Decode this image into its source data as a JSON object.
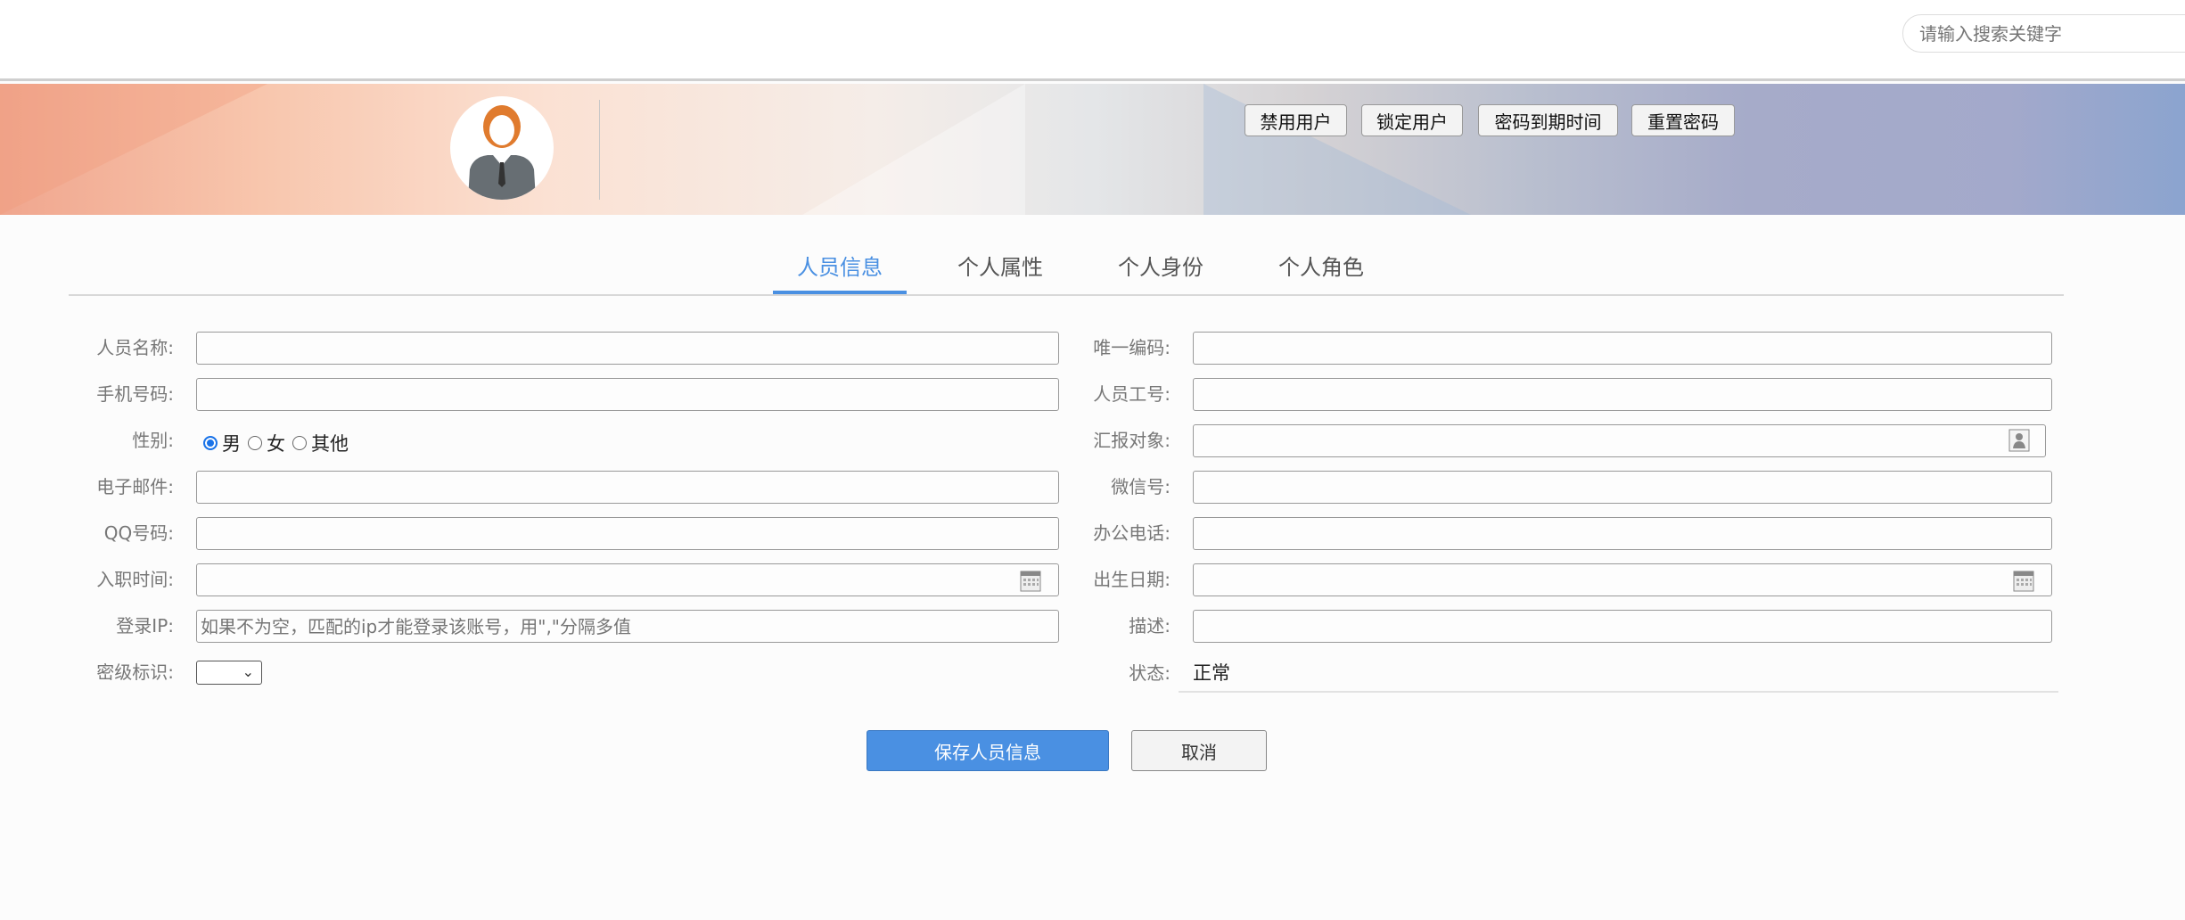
{
  "search": {
    "placeholder": "请输入搜索关键字"
  },
  "header_actions": [
    "禁用用户",
    "锁定用户",
    "密码到期时间",
    "重置密码"
  ],
  "tabs": [
    "人员信息",
    "个人属性",
    "个人身份",
    "个人角色"
  ],
  "active_tab": "人员信息",
  "form": {
    "name_label": "人员名称:",
    "code_label": "唯一编码:",
    "phone_label": "手机号码:",
    "empno_label": "人员工号:",
    "gender_label": "性别:",
    "gender_options": [
      "男",
      "女",
      "其他"
    ],
    "gender_selected": "男",
    "report_label": "汇报对象:",
    "email_label": "电子邮件:",
    "wechat_label": "微信号:",
    "qq_label": "QQ号码:",
    "office_label": "办公电话:",
    "hire_label": "入职时间:",
    "birth_label": "出生日期:",
    "ip_label": "登录IP:",
    "ip_placeholder": "如果不为空，匹配的ip才能登录该账号，用\",\"分隔多值",
    "desc_label": "描述:",
    "secret_label": "密级标识:",
    "status_label": "状态:",
    "status_value": "正常"
  },
  "buttons": {
    "save": "保存人员信息",
    "cancel": "取消"
  },
  "colors": {
    "accent": "#4a90e2"
  }
}
